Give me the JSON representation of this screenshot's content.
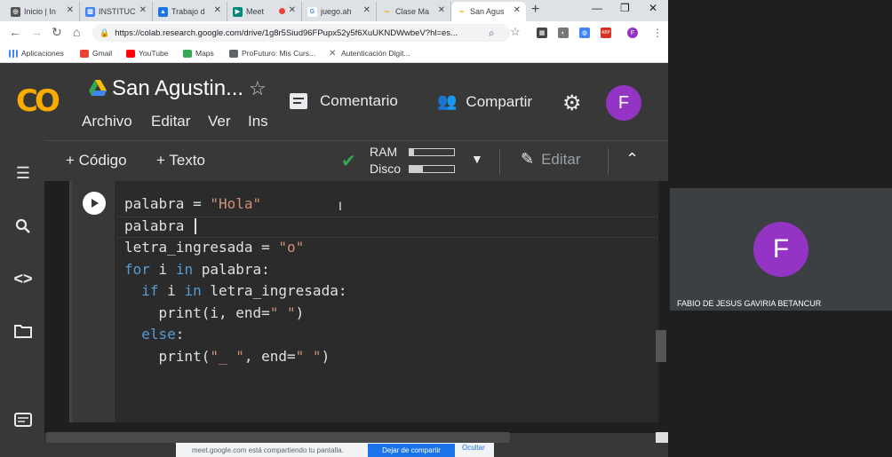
{
  "browser": {
    "tabs": [
      {
        "label": "Inicio | In",
        "icon_color": "#555555"
      },
      {
        "label": "INSTITUC",
        "icon_color": "#4285f4"
      },
      {
        "label": "Trabajo d",
        "icon_color": "#1a73e8"
      },
      {
        "label": "Meet",
        "icon_color": "#00897b"
      },
      {
        "label": "juego.ah",
        "icon_color": "#4285f4"
      },
      {
        "label": "Clase Ma",
        "icon_color": "#f9ab00"
      },
      {
        "label": "San Agus",
        "icon_color": "#f9ab00"
      }
    ],
    "url": "https://colab.research.google.com/drive/1g8r5Siud96FPupx52y5f6XuUKNDWwbeV?hl=es...",
    "bookmarks": [
      "Aplicaciones",
      "Gmail",
      "YouTube",
      "Maps",
      "ProFuturo: Mis Curs...",
      "Autenticación Digit..."
    ],
    "profile_initial": "F"
  },
  "colab": {
    "title": "San Agustin...",
    "menu": [
      "Archivo",
      "Editar",
      "Ver",
      "Ins"
    ],
    "comment_label": "Comentario",
    "share_label": "Compartir",
    "avatar_initial": "F",
    "toolbar": {
      "add_code": "+ Código",
      "add_text": "+ Texto",
      "ram_label": "RAM",
      "disk_label": "Disco",
      "ram_usage": 0.1,
      "disk_usage": 0.3,
      "edit_label": "Editar"
    },
    "code_lines": [
      "palabra = \"Hola\"",
      "palabra ",
      "letra_ingresada = \"o\"",
      "for i in palabra:",
      "  if i in letra_ingresada:",
      "    print(i, end=\" \")",
      "  else:",
      "    print(\"_ \", end=\" \")"
    ]
  },
  "share_bar": {
    "message": "meet.google.com está compartiendo tu pantalla.",
    "stop_label": "Dejar de compartir",
    "hide_label": "Ocultar"
  },
  "participant": {
    "initial": "F",
    "name": "FABIO DE JESUS GAVIRIA BETANCUR"
  },
  "colors": {
    "accent": "#f9ab00",
    "avatar": "#9334c4",
    "keyword": "#569cd6",
    "string": "#ce9178"
  }
}
